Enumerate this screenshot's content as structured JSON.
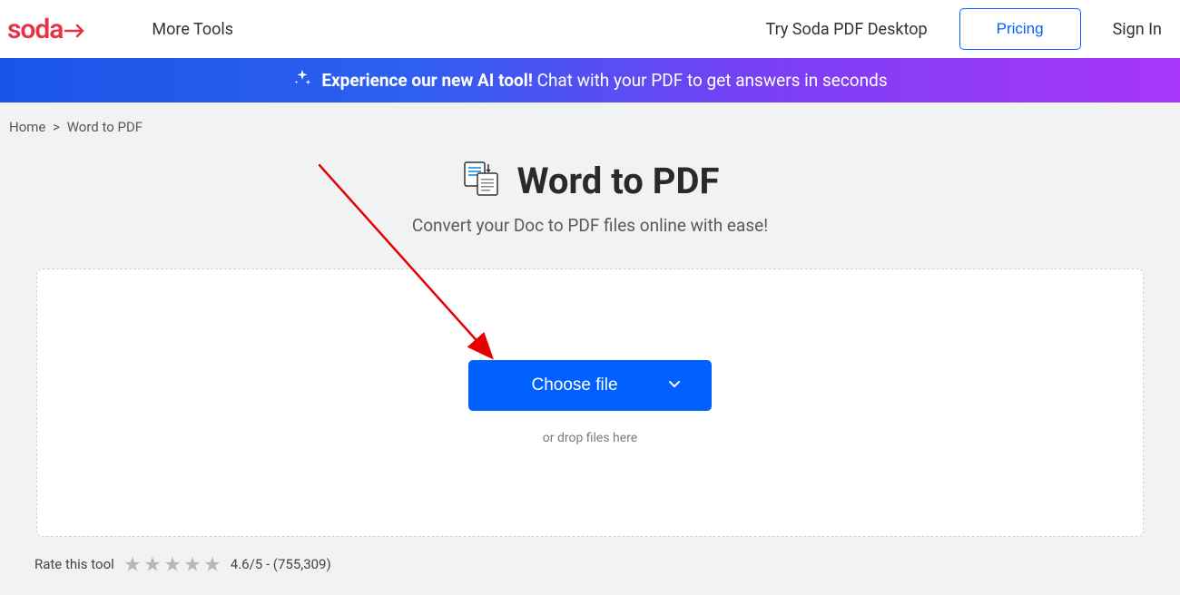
{
  "header": {
    "logo": "soda",
    "more_tools": "More Tools",
    "try_desktop": "Try Soda PDF Desktop",
    "pricing": "Pricing",
    "signin": "Sign In"
  },
  "banner": {
    "bold": "Experience our new AI tool!",
    "text": "Chat with your PDF to get answers in seconds"
  },
  "breadcrumb": {
    "home": "Home",
    "current": "Word to PDF"
  },
  "main": {
    "title": "Word to PDF",
    "subtitle": "Convert your Doc to PDF files online with ease!",
    "choose_file": "Choose file",
    "drop_hint": "or drop files here"
  },
  "rating": {
    "label": "Rate this tool",
    "score": "4.6/5",
    "count": "755,309"
  }
}
